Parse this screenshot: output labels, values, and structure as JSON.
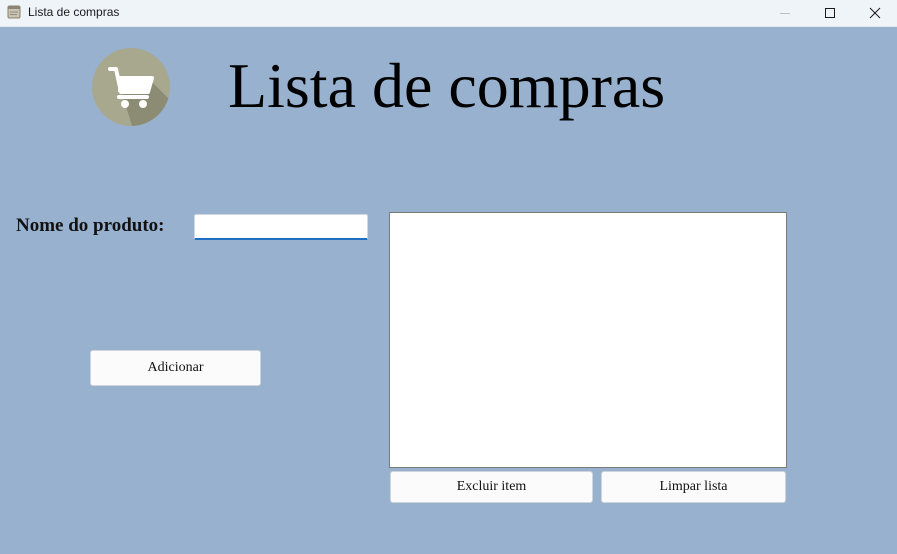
{
  "window": {
    "title": "Lista de compras",
    "icons": {
      "app": "notepad-icon",
      "minimize": "minimize-icon",
      "maximize": "maximize-icon",
      "close": "close-icon"
    }
  },
  "header": {
    "logo_icon": "shopping-cart-icon",
    "title": "Lista de compras"
  },
  "form": {
    "product_label": "Nome do produto:",
    "product_value": "",
    "add_button": "Adicionar"
  },
  "list": {
    "items": [],
    "delete_button": "Excluir item",
    "clear_button": "Limpar lista"
  },
  "colors": {
    "background": "#97b1cf",
    "titlebar": "#eff4f9",
    "logo_circle": "#a8a88e",
    "input_focus": "#1e6fc4"
  }
}
